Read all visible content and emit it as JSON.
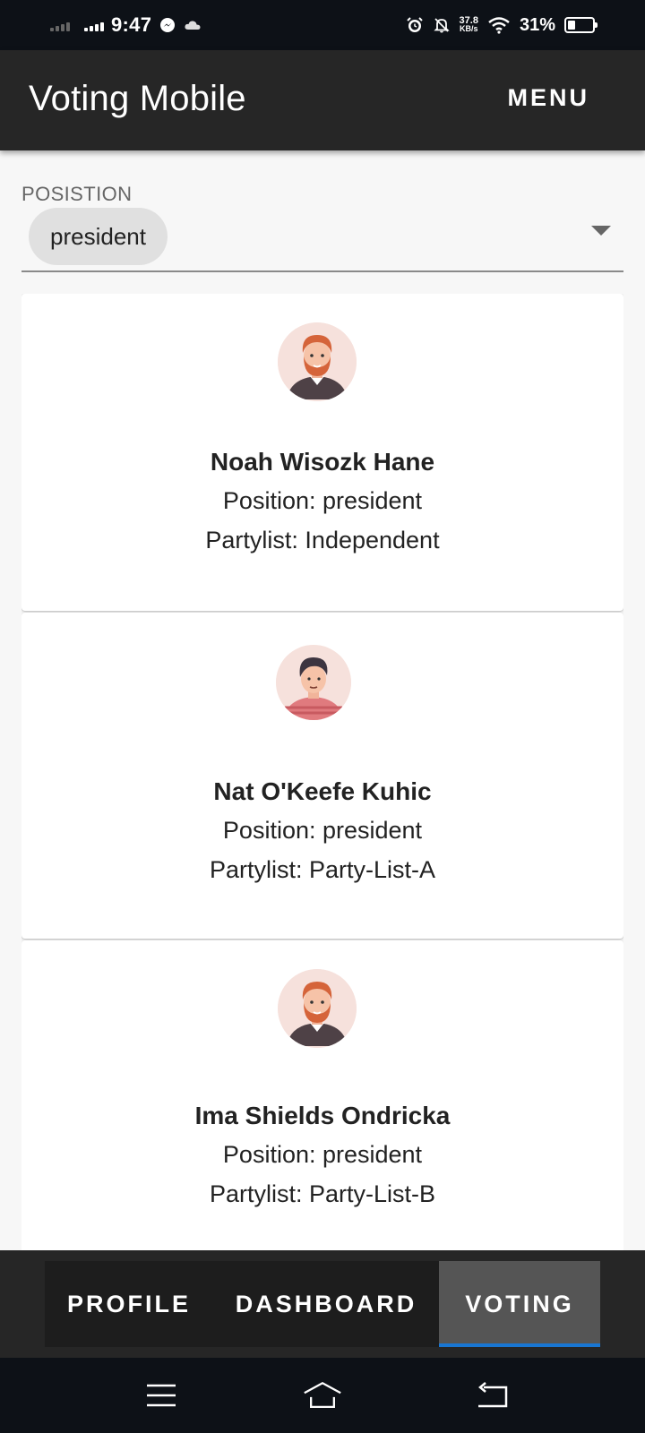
{
  "status_bar": {
    "time": "9:47",
    "net_speed_value": "37.8",
    "net_speed_unit": "KB/s",
    "battery_percent": "31%",
    "battery_level": 0.31,
    "icons": [
      "signal-weak-icon",
      "signal-icon",
      "messenger-icon",
      "cloud-icon",
      "alarm-icon",
      "bell-off-icon",
      "wifi-icon",
      "battery-icon"
    ]
  },
  "app_bar": {
    "title": "Voting Mobile",
    "menu_label": "MENU"
  },
  "position_select": {
    "label": "POSISTION",
    "selected": "president"
  },
  "candidates": [
    {
      "name": "Noah Wisozk Hane",
      "position": "Position: president",
      "partylist": "Partylist: Independent",
      "avatar": "bearded-man-avatar"
    },
    {
      "name": "Nat O'Keefe Kuhic",
      "position": "Position: president",
      "partylist": "Partylist: Party-List-A",
      "avatar": "young-man-avatar"
    },
    {
      "name": "Ima Shields Ondricka",
      "position": "Position: president",
      "partylist": "Partylist: Party-List-B",
      "avatar": "bearded-man-avatar"
    }
  ],
  "bottom_nav": {
    "tabs": [
      "PROFILE",
      "DASHBOARD",
      "VOTING"
    ],
    "active": "VOTING"
  },
  "system_nav": {
    "icons": [
      "recents-menu-icon",
      "home-icon",
      "back-icon"
    ]
  },
  "colors": {
    "app_bar": "#262626",
    "status_bar": "#0d1117",
    "active_tab_indicator": "#1976d2",
    "active_tab_bg": "#555555"
  }
}
